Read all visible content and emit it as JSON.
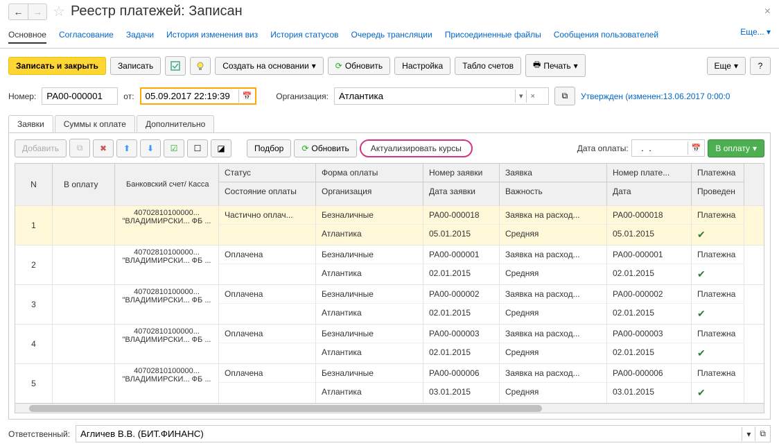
{
  "header": {
    "title": "Реестр платежей: Записан"
  },
  "nav": {
    "tabs": [
      "Основное",
      "Согласование",
      "Задачи",
      "История изменения виз",
      "История статусов",
      "Очередь трансляции",
      "Присоединенные файлы",
      "Сообщения пользователей"
    ],
    "more": "Еще...",
    "active_index": 0
  },
  "toolbar": {
    "save_close": "Записать и закрыть",
    "save": "Записать",
    "create_base": "Создать на основании",
    "refresh": "Обновить",
    "settings": "Настройка",
    "accounts": "Табло счетов",
    "print": "Печать",
    "more": "Еще",
    "help": "?"
  },
  "form": {
    "number_label": "Номер:",
    "number": "РА00-000001",
    "from_label": "от:",
    "date": "05.09.2017 22:19:39",
    "org_label": "Организация:",
    "org": "Атлантика",
    "status_text": "Утвержден (изменен:13.06.2017 0:00:0"
  },
  "sub_tabs": {
    "items": [
      "Заявки",
      "Суммы к оплате",
      "Дополнительно"
    ],
    "active_index": 0
  },
  "grid_toolbar": {
    "add": "Добавить",
    "select": "Подбор",
    "refresh": "Обновить",
    "update_rates": "Актуализировать курсы",
    "pay_date_label": "Дата оплаты:",
    "pay_date": "  .  .    ",
    "to_pay": "В оплату"
  },
  "grid": {
    "headers": {
      "n": "N",
      "to_pay": "В оплату",
      "bank": "Банковский счет/ Касса",
      "status": "Статус",
      "state": "Состояние оплаты",
      "form": "Форма оплаты",
      "org": "Организация",
      "reqnum": "Номер заявки",
      "reqdate": "Дата заявки",
      "req": "Заявка",
      "priority": "Важность",
      "docnum": "Номер плате...",
      "docdate": "Дата",
      "doc": "Платежна",
      "posted": "Проведен"
    },
    "rows": [
      {
        "n": "1",
        "bank": "40702810100000... \"ВЛАДИМИРСКИ... ФБ ...",
        "status": "Частично оплач...",
        "state": "",
        "form": "Безналичные",
        "org": "Атлантика",
        "reqnum": "РА00-000018",
        "reqdate": "05.01.2015",
        "req": "Заявка на расход...",
        "priority": "Средняя",
        "docnum": "РА00-000018",
        "docdate": "05.01.2015",
        "doc": "Платежна",
        "posted": true,
        "selected": true
      },
      {
        "n": "2",
        "bank": "40702810100000... \"ВЛАДИМИРСКИ... ФБ ...",
        "status": "Оплачена",
        "state": "",
        "form": "Безналичные",
        "org": "Атлантика",
        "reqnum": "РА00-000001",
        "reqdate": "02.01.2015",
        "req": "Заявка на расход...",
        "priority": "Средняя",
        "docnum": "РА00-000001",
        "docdate": "02.01.2015",
        "doc": "Платежна",
        "posted": true
      },
      {
        "n": "3",
        "bank": "40702810100000... \"ВЛАДИМИРСКИ... ФБ ...",
        "status": "Оплачена",
        "state": "",
        "form": "Безналичные",
        "org": "Атлантика",
        "reqnum": "РА00-000002",
        "reqdate": "02.01.2015",
        "req": "Заявка на расход...",
        "priority": "Средняя",
        "docnum": "РА00-000002",
        "docdate": "02.01.2015",
        "doc": "Платежна",
        "posted": true
      },
      {
        "n": "4",
        "bank": "40702810100000... \"ВЛАДИМИРСКИ... ФБ ...",
        "status": "Оплачена",
        "state": "",
        "form": "Безналичные",
        "org": "Атлантика",
        "reqnum": "РА00-000003",
        "reqdate": "02.01.2015",
        "req": "Заявка на расход...",
        "priority": "Средняя",
        "docnum": "РА00-000003",
        "docdate": "02.01.2015",
        "doc": "Платежна",
        "posted": true
      },
      {
        "n": "5",
        "bank": "40702810100000... \"ВЛАДИМИРСКИ... ФБ ...",
        "status": "Оплачена",
        "state": "",
        "form": "Безналичные",
        "org": "Атлантика",
        "reqnum": "РА00-000006",
        "reqdate": "03.01.2015",
        "req": "Заявка на расход...",
        "priority": "Средняя",
        "docnum": "РА00-000006",
        "docdate": "03.01.2015",
        "doc": "Платежна",
        "posted": true
      }
    ]
  },
  "footer": {
    "label": "Ответственный:",
    "value": "Агличев В.В. (БИТ.ФИНАНС)"
  }
}
